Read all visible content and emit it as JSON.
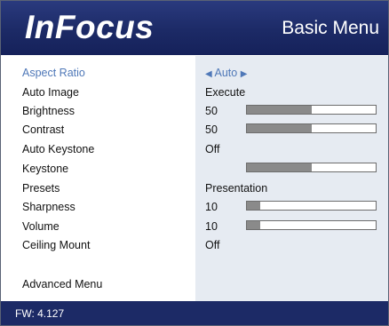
{
  "header": {
    "logo_text": "InFocus",
    "menu_title": "Basic Menu"
  },
  "menu_items": [
    {
      "label": "Aspect Ratio",
      "value": "Auto",
      "selected": true
    },
    {
      "label": "Auto Image",
      "value": "Execute"
    },
    {
      "label": "Brightness",
      "value": "50",
      "level": 0.5
    },
    {
      "label": "Contrast",
      "value": "50",
      "level": 0.5
    },
    {
      "label": "Auto Keystone",
      "value": "Off"
    },
    {
      "label": "Keystone",
      "value": "",
      "level": 0.5
    },
    {
      "label": "Presets",
      "value": "Presentation"
    },
    {
      "label": "Sharpness",
      "value": "10",
      "level": 0.1
    },
    {
      "label": "Volume",
      "value": "10",
      "level": 0.1
    },
    {
      "label": "Ceiling Mount",
      "value": "Off"
    }
  ],
  "advanced_menu": {
    "label": "Advanced Menu"
  },
  "footer": {
    "firmware": "FW: 4.127"
  },
  "colors": {
    "header_bg": "#1c2a66",
    "accent": "#4f78b8",
    "value_panel": "#e6ebf2",
    "slider_fill": "#8a8a8a"
  },
  "icons": {
    "left": "triangle-left-icon",
    "right": "triangle-right-icon"
  }
}
